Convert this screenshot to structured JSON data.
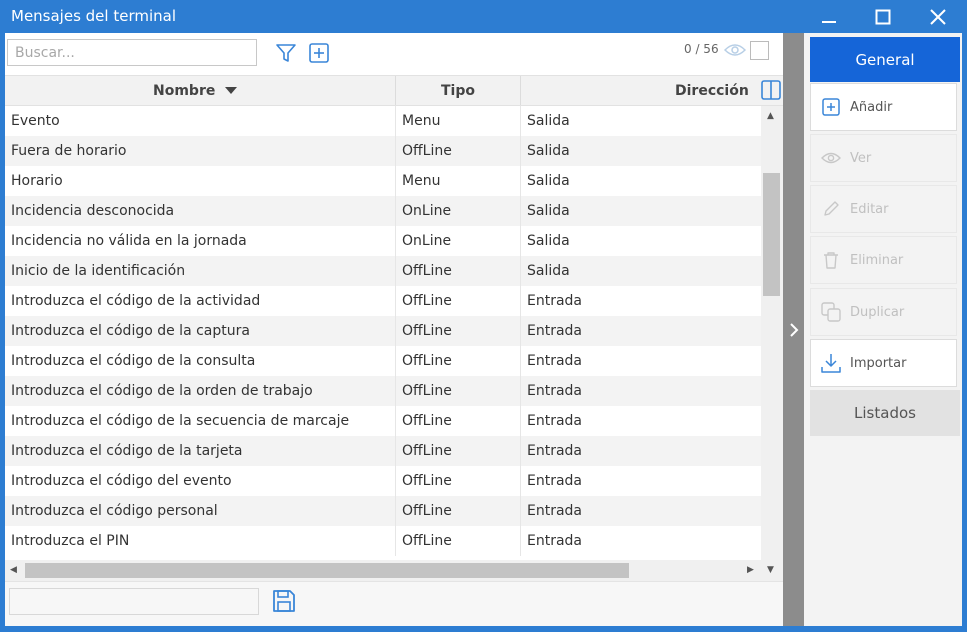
{
  "window": {
    "title": "Mensajes del terminal"
  },
  "toolbar": {
    "search_placeholder": "Buscar...",
    "counter": "0 / 56"
  },
  "table": {
    "columns": [
      {
        "label": "Nombre",
        "sort": "descending"
      },
      {
        "label": "Tipo"
      },
      {
        "label": "Dirección"
      }
    ],
    "rows": [
      {
        "nombre": "Evento",
        "tipo": "Menu",
        "direccion": "Salida"
      },
      {
        "nombre": "Fuera de horario",
        "tipo": "OffLine",
        "direccion": "Salida"
      },
      {
        "nombre": "Horario",
        "tipo": "Menu",
        "direccion": "Salida"
      },
      {
        "nombre": "Incidencia desconocida",
        "tipo": "OnLine",
        "direccion": "Salida"
      },
      {
        "nombre": "Incidencia no válida en la jornada",
        "tipo": "OnLine",
        "direccion": "Salida"
      },
      {
        "nombre": "Inicio de la identificación",
        "tipo": "OffLine",
        "direccion": "Salida"
      },
      {
        "nombre": "Introduzca el código de la actividad",
        "tipo": "OffLine",
        "direccion": "Entrada"
      },
      {
        "nombre": "Introduzca el código de la captura",
        "tipo": "OffLine",
        "direccion": "Entrada"
      },
      {
        "nombre": "Introduzca el código de la consulta",
        "tipo": "OffLine",
        "direccion": "Entrada"
      },
      {
        "nombre": "Introduzca el código de la orden de trabajo",
        "tipo": "OffLine",
        "direccion": "Entrada"
      },
      {
        "nombre": "Introduzca el código de la secuencia de marcaje",
        "tipo": "OffLine",
        "direccion": "Entrada"
      },
      {
        "nombre": "Introduzca el código de la tarjeta",
        "tipo": "OffLine",
        "direccion": "Entrada"
      },
      {
        "nombre": "Introduzca el código del evento",
        "tipo": "OffLine",
        "direccion": "Entrada"
      },
      {
        "nombre": "Introduzca el código personal",
        "tipo": "OffLine",
        "direccion": "Entrada"
      },
      {
        "nombre": "Introduzca el PIN",
        "tipo": "OffLine",
        "direccion": "Entrada"
      }
    ]
  },
  "panel": {
    "tab": "General",
    "actions": [
      {
        "label": "Añadir",
        "icon": "plus-square-icon",
        "enabled": true
      },
      {
        "label": "Ver",
        "icon": "eye-icon",
        "enabled": false
      },
      {
        "label": "Editar",
        "icon": "pencil-icon",
        "enabled": false
      },
      {
        "label": "Eliminar",
        "icon": "trash-icon",
        "enabled": false
      },
      {
        "label": "Duplicar",
        "icon": "copy-icon",
        "enabled": false
      },
      {
        "label": "Importar",
        "icon": "download-icon",
        "enabled": true
      }
    ],
    "listados": "Listados"
  },
  "colors": {
    "titlebar": "#2d7dd2",
    "accent": "#1565d8",
    "icon_blue": "#3a86d8"
  }
}
